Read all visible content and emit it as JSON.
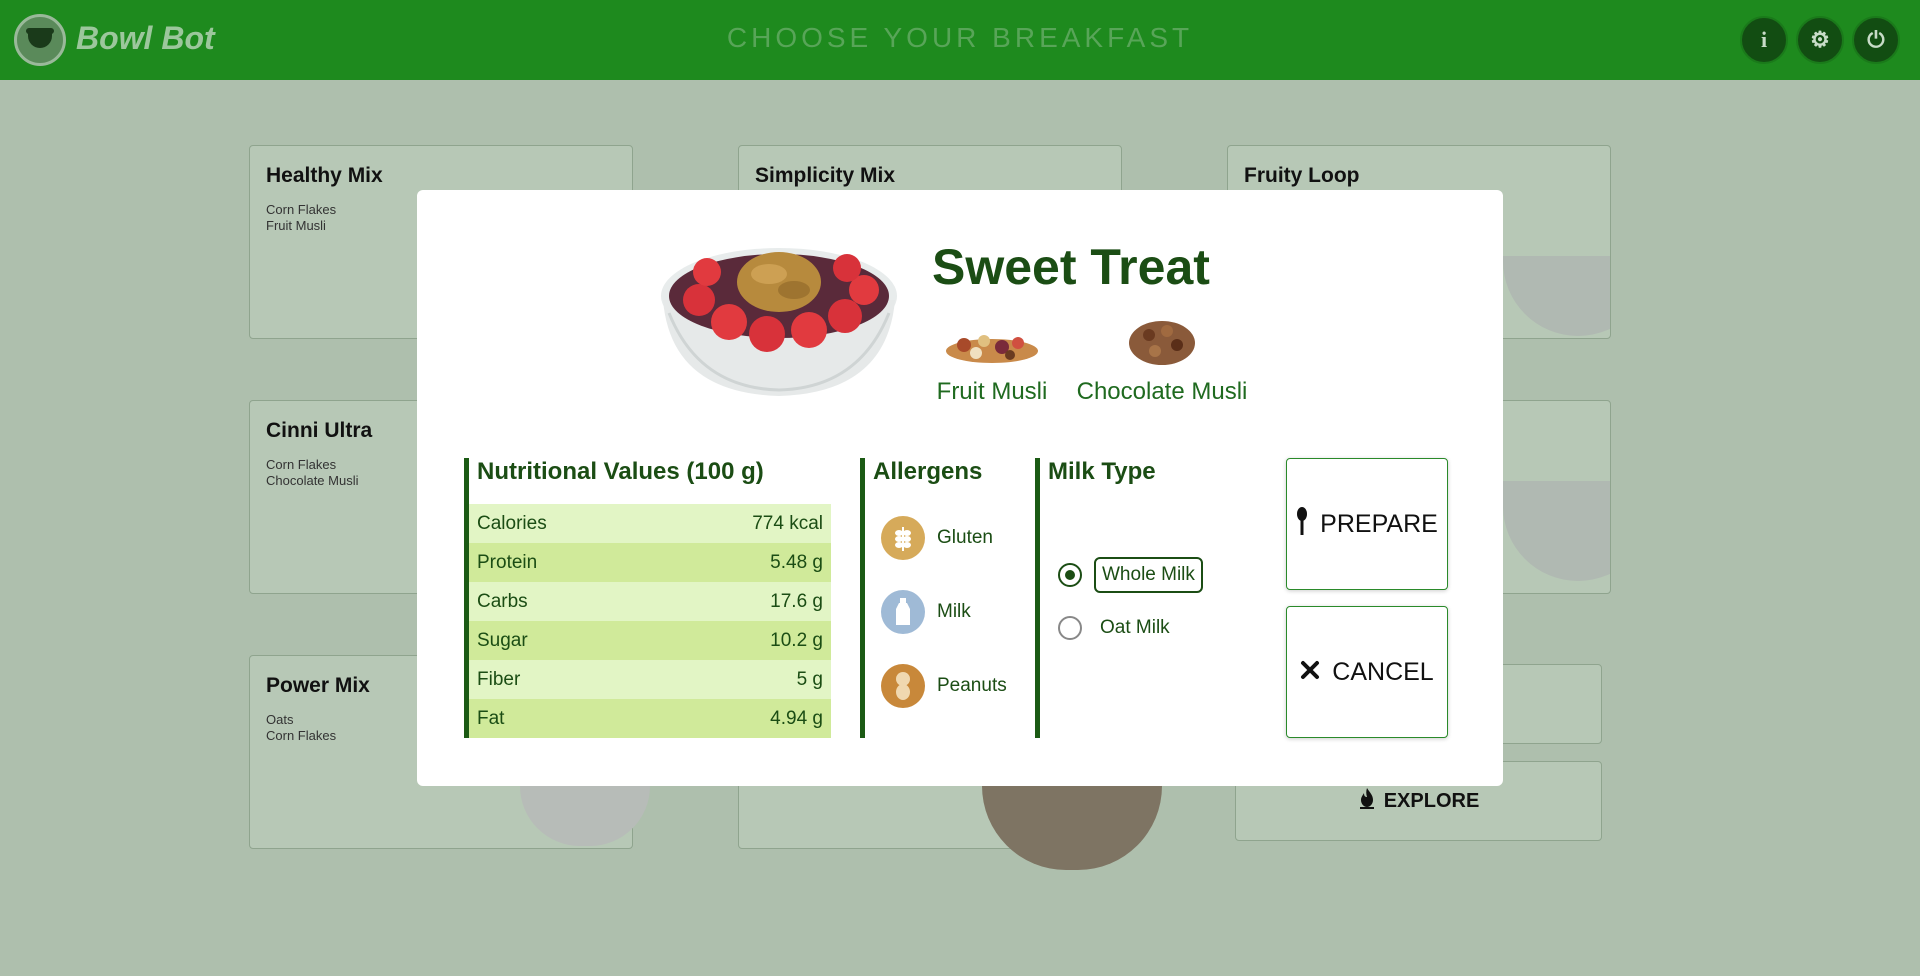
{
  "header": {
    "brand": "Bowl Bot",
    "title": "CHOOSE YOUR BREAKFAST",
    "buttons": {
      "info": "i",
      "settings": "⚙",
      "power": "⏻"
    }
  },
  "cards": [
    {
      "title": "Healthy Mix",
      "items": [
        "Corn Flakes",
        "Fruit Musli"
      ]
    },
    {
      "title": "Simplicity Mix",
      "items": []
    },
    {
      "title": "Fruity Loop",
      "items": []
    },
    {
      "title": "Cinni Ultra",
      "items": [
        "Corn Flakes",
        "Chocolate Musli"
      ]
    },
    {
      "title": "Power Mix",
      "items": [
        "Oats",
        "Corn Flakes"
      ]
    }
  ],
  "explore_label": "EXPLORE",
  "modal": {
    "title": "Sweet Treat",
    "ingredients": [
      "Fruit Musli",
      "Chocolate Musli"
    ],
    "nutrition": {
      "title": "Nutritional Values (100 g)",
      "rows": [
        {
          "label": "Calories",
          "value": "774 kcal"
        },
        {
          "label": "Protein",
          "value": "5.48 g"
        },
        {
          "label": "Carbs",
          "value": "17.6 g"
        },
        {
          "label": "Sugar",
          "value": "10.2 g"
        },
        {
          "label": "Fiber",
          "value": "5 g"
        },
        {
          "label": "Fat",
          "value": "4.94 g"
        }
      ]
    },
    "allergens": {
      "title": "Allergens",
      "items": [
        "Gluten",
        "Milk",
        "Peanuts"
      ]
    },
    "milk": {
      "title": "Milk Type",
      "options": [
        {
          "label": "Whole Milk",
          "selected": true
        },
        {
          "label": "Oat Milk",
          "selected": false
        }
      ]
    },
    "actions": {
      "prepare": "PREPARE",
      "cancel": "CANCEL"
    }
  },
  "colors": {
    "header_bg": "#1e8a1e",
    "accent": "#1b4d14",
    "row_light": "#e2f5c5",
    "row_dark": "#d0ea9a"
  },
  "icons": [
    "logo-bowl-icon",
    "info-icon",
    "gear-icon",
    "power-icon",
    "spoon-icon",
    "close-icon",
    "wheat-icon",
    "milk-bottle-icon",
    "peanut-icon",
    "fire-icon"
  ]
}
